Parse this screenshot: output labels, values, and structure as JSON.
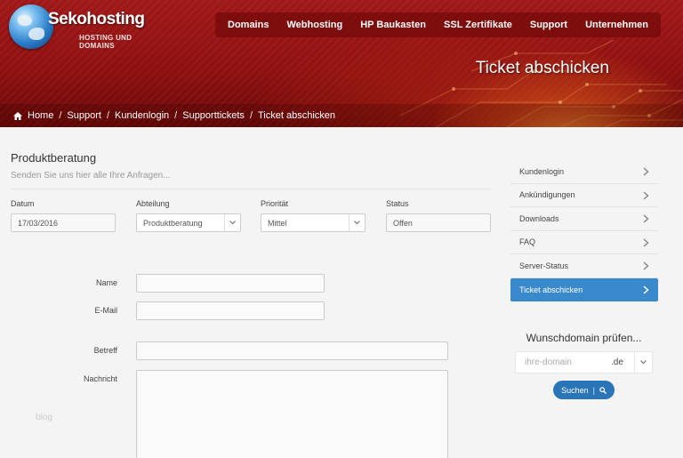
{
  "logo": {
    "name": "Sekohosting",
    "tagline": "HOSTING UND DOMAINS"
  },
  "nav": [
    "Domains",
    "Webhosting",
    "HP Baukasten",
    "SSL Zertifikate",
    "Support",
    "Unternehmen"
  ],
  "page_heading": "Ticket abschicken",
  "breadcrumb": {
    "items": [
      "Home",
      "Support",
      "Kundenlogin",
      "Supporttickets",
      "Ticket abschicken"
    ],
    "separator": "/"
  },
  "form": {
    "title": "Produktberatung",
    "subtitle": "Senden Sie uns hier alle Ihre Anfragen...",
    "meta": {
      "datum": {
        "label": "Datum",
        "value": "17/03/2016"
      },
      "abteilung": {
        "label": "Abteilung",
        "value": "Produktberatung"
      },
      "prioritaet": {
        "label": "Priorität",
        "value": "Mittel"
      },
      "status": {
        "label": "Status",
        "value": "Offen"
      }
    },
    "name_label": "Name",
    "email_label": "E-Mail",
    "betreff_label": "Betreff",
    "nachricht_label": "Nachricht"
  },
  "watermark": "blog",
  "sidebar": {
    "items": [
      "Kundenlogin",
      "Ankündigungen",
      "Downloads",
      "FAQ",
      "Server-Status",
      "Ticket abschicken"
    ],
    "active": "Ticket abschicken"
  },
  "domain_check": {
    "title": "Wunschdomain prüfen...",
    "placeholder": "ihre-domain",
    "tld": ".de",
    "button": "Suchen"
  },
  "colors": {
    "header_red": "#9a1414",
    "accent_blue": "#3a89cc",
    "button_blue": "#2a74b8"
  }
}
